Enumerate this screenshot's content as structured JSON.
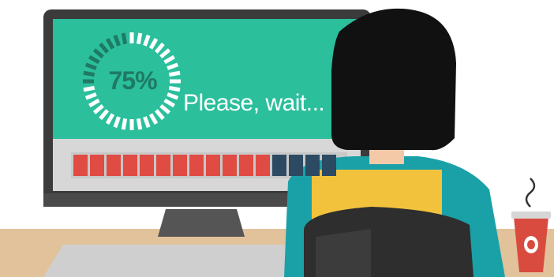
{
  "loading": {
    "percent_label": "75%",
    "message": "Please, wait...",
    "progress": 0.75
  },
  "progress_bar": {
    "segments_total": 16,
    "segments_filled": 12
  },
  "colors": {
    "screen": "#2bbf9c",
    "screen_dark": "#1f7a63",
    "bezel": "#3b3b3b",
    "bar_filled": "#e04b43",
    "bar_empty": "#2d4a63",
    "desk": "#e2c29b",
    "hair": "#111111",
    "shirt_teal": "#1aa1a8",
    "shirt_yellow": "#f3c23d",
    "chair": "#2e2e2e",
    "cup_red": "#d94b3f"
  },
  "icons": [
    "spinner-ring-icon",
    "steam-icon",
    "coffee-cup-icon"
  ]
}
